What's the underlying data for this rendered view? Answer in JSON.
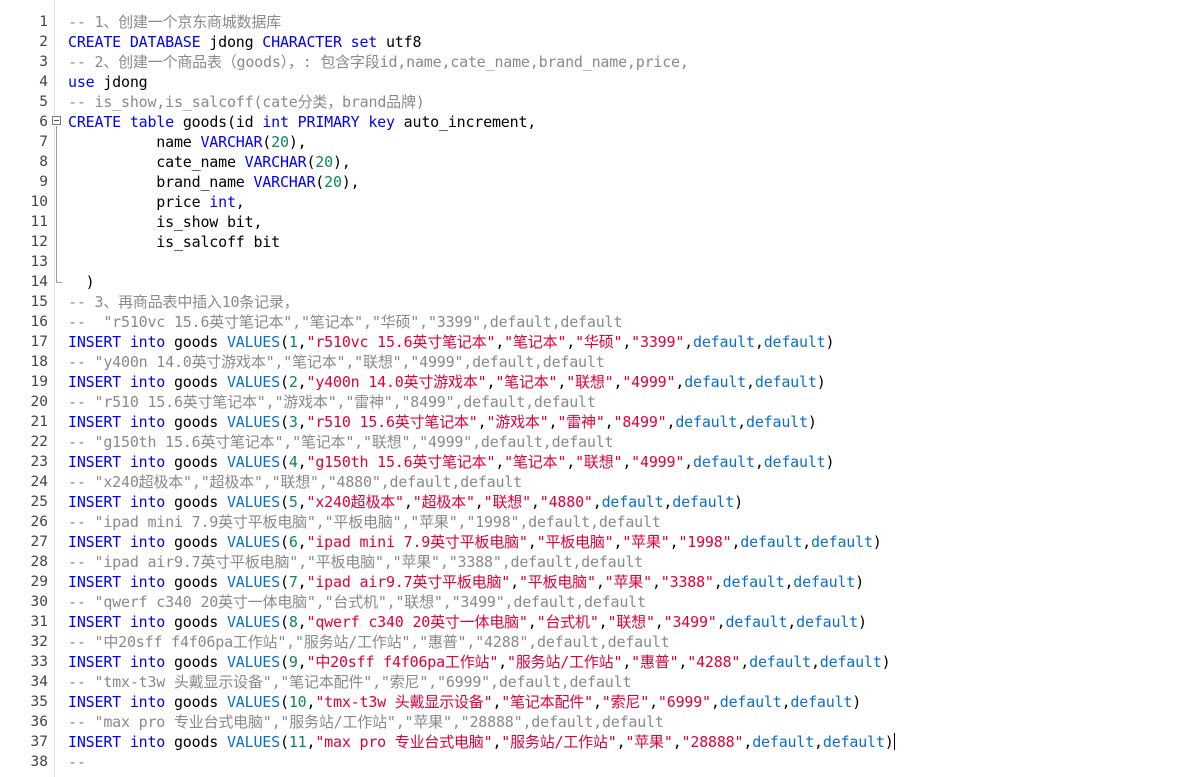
{
  "editor": {
    "colors": {
      "keyword": "#0000ff",
      "function": "#0a6ed1",
      "string": "#e0003a",
      "number": "#09885a",
      "comment": "#8a8a8a",
      "text": "#000000"
    },
    "fold_marker_line": 6,
    "fold_end_line": 14,
    "caret_line": 37,
    "lines": [
      {
        "n": "1",
        "parts": [
          [
            "c",
            "-- 1、创建一个京东商城数据库"
          ]
        ]
      },
      {
        "n": "2",
        "parts": [
          [
            "k",
            "CREATE DATABASE"
          ],
          [
            "t",
            " jdong "
          ],
          [
            "k",
            "CHARACTER"
          ],
          [
            "t",
            " "
          ],
          [
            "k",
            "set"
          ],
          [
            "t",
            " utf8"
          ]
        ]
      },
      {
        "n": "3",
        "parts": [
          [
            "c",
            "-- 2、创建一个商品表（goods），: 包含字段id,name,cate_name,brand_name,price,"
          ]
        ]
      },
      {
        "n": "4",
        "parts": [
          [
            "k",
            "use"
          ],
          [
            "t",
            " jdong"
          ]
        ]
      },
      {
        "n": "5",
        "parts": [
          [
            "c",
            "-- is_show,is_salcoff(cate分类，brand品牌)"
          ]
        ]
      },
      {
        "n": "6",
        "parts": [
          [
            "k",
            "CREATE"
          ],
          [
            "t",
            " "
          ],
          [
            "k",
            "table"
          ],
          [
            "t",
            " goods(id "
          ],
          [
            "k",
            "int"
          ],
          [
            "t",
            " "
          ],
          [
            "k",
            "PRIMARY"
          ],
          [
            "t",
            " "
          ],
          [
            "k",
            "key"
          ],
          [
            "t",
            " auto_increment,"
          ]
        ]
      },
      {
        "n": "7",
        "parts": [
          [
            "t",
            "          name "
          ],
          [
            "k",
            "VARCHAR"
          ],
          [
            "t",
            "("
          ],
          [
            "n",
            "20"
          ],
          [
            "t",
            "),"
          ]
        ]
      },
      {
        "n": "8",
        "parts": [
          [
            "t",
            "          cate_name "
          ],
          [
            "k",
            "VARCHAR"
          ],
          [
            "t",
            "("
          ],
          [
            "n",
            "20"
          ],
          [
            "t",
            "),"
          ]
        ]
      },
      {
        "n": "9",
        "parts": [
          [
            "t",
            "          brand_name "
          ],
          [
            "k",
            "VARCHAR"
          ],
          [
            "t",
            "("
          ],
          [
            "n",
            "20"
          ],
          [
            "t",
            "),"
          ]
        ]
      },
      {
        "n": "10",
        "parts": [
          [
            "t",
            "          price "
          ],
          [
            "k",
            "int"
          ],
          [
            "t",
            ","
          ]
        ]
      },
      {
        "n": "11",
        "parts": [
          [
            "t",
            "          is_show bit,"
          ]
        ]
      },
      {
        "n": "12",
        "parts": [
          [
            "t",
            "          is_salcoff bit"
          ]
        ]
      },
      {
        "n": "13",
        "parts": []
      },
      {
        "n": "14",
        "parts": [
          [
            "t",
            "  )"
          ]
        ]
      },
      {
        "n": "15",
        "parts": [
          [
            "c",
            "-- 3、再商品表中插入10条记录，"
          ]
        ]
      },
      {
        "n": "16",
        "parts": [
          [
            "c",
            "--  \"r510vc 15.6英寸笔记本\",\"笔记本\",\"华硕\",\"3399\",default,default"
          ]
        ]
      },
      {
        "n": "17",
        "parts": [
          [
            "k",
            "INSERT into"
          ],
          [
            "t",
            " goods "
          ],
          [
            "f",
            "VALUES"
          ],
          [
            "t",
            "("
          ],
          [
            "n",
            "1"
          ],
          [
            "t",
            ","
          ],
          [
            "s",
            "\"r510vc 15.6英寸笔记本\""
          ],
          [
            "t",
            ","
          ],
          [
            "s",
            "\"笔记本\""
          ],
          [
            "t",
            ","
          ],
          [
            "s",
            "\"华硕\""
          ],
          [
            "t",
            ","
          ],
          [
            "s",
            "\"3399\""
          ],
          [
            "t",
            ","
          ],
          [
            "f",
            "default"
          ],
          [
            "t",
            ","
          ],
          [
            "f",
            "default"
          ],
          [
            "t",
            ")"
          ]
        ]
      },
      {
        "n": "18",
        "parts": [
          [
            "c",
            "-- \"y400n 14.0英寸游戏本\",\"笔记本\",\"联想\",\"4999\",default,default"
          ]
        ]
      },
      {
        "n": "19",
        "parts": [
          [
            "k",
            "INSERT into"
          ],
          [
            "t",
            " goods "
          ],
          [
            "f",
            "VALUES"
          ],
          [
            "t",
            "("
          ],
          [
            "n",
            "2"
          ],
          [
            "t",
            ","
          ],
          [
            "s",
            "\"y400n 14.0英寸游戏本\""
          ],
          [
            "t",
            ","
          ],
          [
            "s",
            "\"笔记本\""
          ],
          [
            "t",
            ","
          ],
          [
            "s",
            "\"联想\""
          ],
          [
            "t",
            ","
          ],
          [
            "s",
            "\"4999\""
          ],
          [
            "t",
            ","
          ],
          [
            "f",
            "default"
          ],
          [
            "t",
            ","
          ],
          [
            "f",
            "default"
          ],
          [
            "t",
            ")"
          ]
        ]
      },
      {
        "n": "20",
        "parts": [
          [
            "c",
            "-- \"r510 15.6英寸笔记本\",\"游戏本\",\"雷神\",\"8499\",default,default"
          ]
        ]
      },
      {
        "n": "21",
        "parts": [
          [
            "k",
            "INSERT into"
          ],
          [
            "t",
            " goods "
          ],
          [
            "f",
            "VALUES"
          ],
          [
            "t",
            "("
          ],
          [
            "n",
            "3"
          ],
          [
            "t",
            ","
          ],
          [
            "s",
            "\"r510 15.6英寸笔记本\""
          ],
          [
            "t",
            ","
          ],
          [
            "s",
            "\"游戏本\""
          ],
          [
            "t",
            ","
          ],
          [
            "s",
            "\"雷神\""
          ],
          [
            "t",
            ","
          ],
          [
            "s",
            "\"8499\""
          ],
          [
            "t",
            ","
          ],
          [
            "f",
            "default"
          ],
          [
            "t",
            ","
          ],
          [
            "f",
            "default"
          ],
          [
            "t",
            ")"
          ]
        ]
      },
      {
        "n": "22",
        "parts": [
          [
            "c",
            "-- \"g150th 15.6英寸笔记本\",\"笔记本\",\"联想\",\"4999\",default,default"
          ]
        ]
      },
      {
        "n": "23",
        "parts": [
          [
            "k",
            "INSERT into"
          ],
          [
            "t",
            " goods "
          ],
          [
            "f",
            "VALUES"
          ],
          [
            "t",
            "("
          ],
          [
            "n",
            "4"
          ],
          [
            "t",
            ","
          ],
          [
            "s",
            "\"g150th 15.6英寸笔记本\""
          ],
          [
            "t",
            ","
          ],
          [
            "s",
            "\"笔记本\""
          ],
          [
            "t",
            ","
          ],
          [
            "s",
            "\"联想\""
          ],
          [
            "t",
            ","
          ],
          [
            "s",
            "\"4999\""
          ],
          [
            "t",
            ","
          ],
          [
            "f",
            "default"
          ],
          [
            "t",
            ","
          ],
          [
            "f",
            "default"
          ],
          [
            "t",
            ")"
          ]
        ]
      },
      {
        "n": "24",
        "parts": [
          [
            "c",
            "-- \"x240超极本\",\"超极本\",\"联想\",\"4880\",default,default"
          ]
        ]
      },
      {
        "n": "25",
        "parts": [
          [
            "k",
            "INSERT into"
          ],
          [
            "t",
            " goods "
          ],
          [
            "f",
            "VALUES"
          ],
          [
            "t",
            "("
          ],
          [
            "n",
            "5"
          ],
          [
            "t",
            ","
          ],
          [
            "s",
            "\"x240超极本\""
          ],
          [
            "t",
            ","
          ],
          [
            "s",
            "\"超极本\""
          ],
          [
            "t",
            ","
          ],
          [
            "s",
            "\"联想\""
          ],
          [
            "t",
            ","
          ],
          [
            "s",
            "\"4880\""
          ],
          [
            "t",
            ","
          ],
          [
            "f",
            "default"
          ],
          [
            "t",
            ","
          ],
          [
            "f",
            "default"
          ],
          [
            "t",
            ")"
          ]
        ]
      },
      {
        "n": "26",
        "parts": [
          [
            "c",
            "-- \"ipad mini 7.9英寸平板电脑\",\"平板电脑\",\"苹果\",\"1998\",default,default"
          ]
        ]
      },
      {
        "n": "27",
        "parts": [
          [
            "k",
            "INSERT into"
          ],
          [
            "t",
            " goods "
          ],
          [
            "f",
            "VALUES"
          ],
          [
            "t",
            "("
          ],
          [
            "n",
            "6"
          ],
          [
            "t",
            ","
          ],
          [
            "s",
            "\"ipad mini 7.9英寸平板电脑\""
          ],
          [
            "t",
            ","
          ],
          [
            "s",
            "\"平板电脑\""
          ],
          [
            "t",
            ","
          ],
          [
            "s",
            "\"苹果\""
          ],
          [
            "t",
            ","
          ],
          [
            "s",
            "\"1998\""
          ],
          [
            "t",
            ","
          ],
          [
            "f",
            "default"
          ],
          [
            "t",
            ","
          ],
          [
            "f",
            "default"
          ],
          [
            "t",
            ")"
          ]
        ]
      },
      {
        "n": "28",
        "parts": [
          [
            "c",
            "-- \"ipad air9.7英寸平板电脑\",\"平板电脑\",\"苹果\",\"3388\",default,default"
          ]
        ]
      },
      {
        "n": "29",
        "parts": [
          [
            "k",
            "INSERT into"
          ],
          [
            "t",
            " goods "
          ],
          [
            "f",
            "VALUES"
          ],
          [
            "t",
            "("
          ],
          [
            "n",
            "7"
          ],
          [
            "t",
            ","
          ],
          [
            "s",
            "\"ipad air9.7英寸平板电脑\""
          ],
          [
            "t",
            ","
          ],
          [
            "s",
            "\"平板电脑\""
          ],
          [
            "t",
            ","
          ],
          [
            "s",
            "\"苹果\""
          ],
          [
            "t",
            ","
          ],
          [
            "s",
            "\"3388\""
          ],
          [
            "t",
            ","
          ],
          [
            "f",
            "default"
          ],
          [
            "t",
            ","
          ],
          [
            "f",
            "default"
          ],
          [
            "t",
            ")"
          ]
        ]
      },
      {
        "n": "30",
        "parts": [
          [
            "c",
            "-- \"qwerf c340 20英寸一体电脑\",\"台式机\",\"联想\",\"3499\",default,default"
          ]
        ]
      },
      {
        "n": "31",
        "parts": [
          [
            "k",
            "INSERT into"
          ],
          [
            "t",
            " goods "
          ],
          [
            "f",
            "VALUES"
          ],
          [
            "t",
            "("
          ],
          [
            "n",
            "8"
          ],
          [
            "t",
            ","
          ],
          [
            "s",
            "\"qwerf c340 20英寸一体电脑\""
          ],
          [
            "t",
            ","
          ],
          [
            "s",
            "\"台式机\""
          ],
          [
            "t",
            ","
          ],
          [
            "s",
            "\"联想\""
          ],
          [
            "t",
            ","
          ],
          [
            "s",
            "\"3499\""
          ],
          [
            "t",
            ","
          ],
          [
            "f",
            "default"
          ],
          [
            "t",
            ","
          ],
          [
            "f",
            "default"
          ],
          [
            "t",
            ")"
          ]
        ]
      },
      {
        "n": "32",
        "parts": [
          [
            "c",
            "-- \"中20sff f4f06pa工作站\",\"服务站/工作站\",\"惠普\",\"4288\",default,default"
          ]
        ]
      },
      {
        "n": "33",
        "parts": [
          [
            "k",
            "INSERT into"
          ],
          [
            "t",
            " goods "
          ],
          [
            "f",
            "VALUES"
          ],
          [
            "t",
            "("
          ],
          [
            "n",
            "9"
          ],
          [
            "t",
            ","
          ],
          [
            "s",
            "\"中20sff f4f06pa工作站\""
          ],
          [
            "t",
            ","
          ],
          [
            "s",
            "\"服务站/工作站\""
          ],
          [
            "t",
            ","
          ],
          [
            "s",
            "\"惠普\""
          ],
          [
            "t",
            ","
          ],
          [
            "s",
            "\"4288\""
          ],
          [
            "t",
            ","
          ],
          [
            "f",
            "default"
          ],
          [
            "t",
            ","
          ],
          [
            "f",
            "default"
          ],
          [
            "t",
            ")"
          ]
        ]
      },
      {
        "n": "34",
        "parts": [
          [
            "c",
            "-- \"tmx-t3w 头戴显示设备\",\"笔记本配件\",\"索尼\",\"6999\",default,default"
          ]
        ]
      },
      {
        "n": "35",
        "parts": [
          [
            "k",
            "INSERT into"
          ],
          [
            "t",
            " goods "
          ],
          [
            "f",
            "VALUES"
          ],
          [
            "t",
            "("
          ],
          [
            "n",
            "10"
          ],
          [
            "t",
            ","
          ],
          [
            "s",
            "\"tmx-t3w 头戴显示设备\""
          ],
          [
            "t",
            ","
          ],
          [
            "s",
            "\"笔记本配件\""
          ],
          [
            "t",
            ","
          ],
          [
            "s",
            "\"索尼\""
          ],
          [
            "t",
            ","
          ],
          [
            "s",
            "\"6999\""
          ],
          [
            "t",
            ","
          ],
          [
            "f",
            "default"
          ],
          [
            "t",
            ","
          ],
          [
            "f",
            "default"
          ],
          [
            "t",
            ")"
          ]
        ]
      },
      {
        "n": "36",
        "parts": [
          [
            "c",
            "-- \"max pro 专业台式电脑\",\"服务站/工作站\",\"苹果\",\"28888\",default,default"
          ]
        ]
      },
      {
        "n": "37",
        "parts": [
          [
            "k",
            "INSERT into"
          ],
          [
            "t",
            " goods "
          ],
          [
            "f",
            "VALUES"
          ],
          [
            "t",
            "("
          ],
          [
            "n",
            "11"
          ],
          [
            "t",
            ","
          ],
          [
            "s",
            "\"max pro 专业台式电脑\""
          ],
          [
            "t",
            ","
          ],
          [
            "s",
            "\"服务站/工作站\""
          ],
          [
            "t",
            ","
          ],
          [
            "s",
            "\"苹果\""
          ],
          [
            "t",
            ","
          ],
          [
            "s",
            "\"28888\""
          ],
          [
            "t",
            ","
          ],
          [
            "f",
            "default"
          ],
          [
            "t",
            ","
          ],
          [
            "f",
            "default"
          ],
          [
            "t",
            ")"
          ]
        ]
      },
      {
        "n": "38",
        "parts": [
          [
            "c",
            "--"
          ]
        ]
      }
    ]
  }
}
